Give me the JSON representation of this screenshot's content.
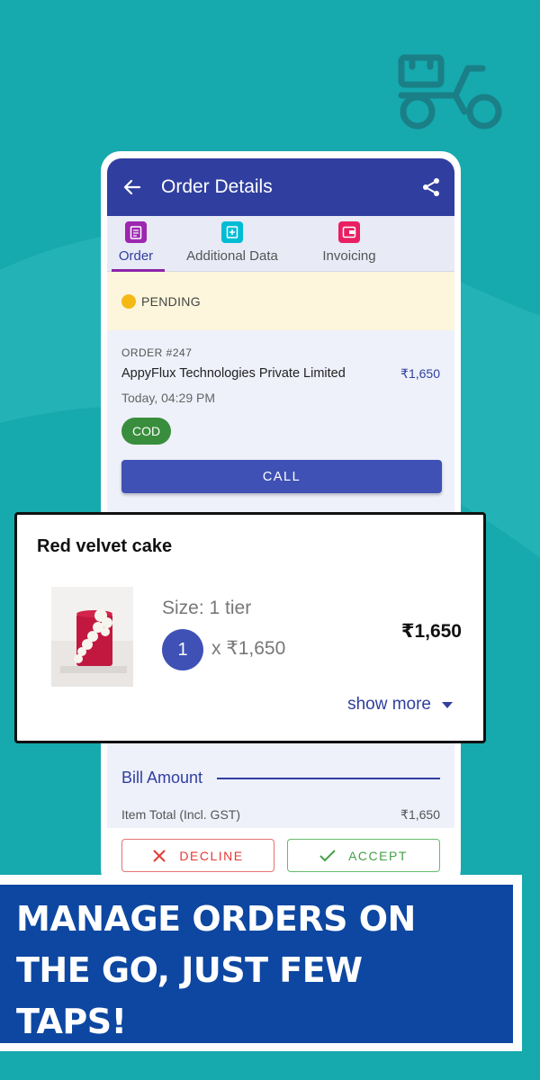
{
  "colors": {
    "background": "#16a9ad",
    "appbar": "#303f9f",
    "banner": "#0d47a1",
    "pending_dot": "#f5b915",
    "cod_badge": "#388e3c"
  },
  "appbar": {
    "title": "Order Details",
    "back_icon": "arrow-back-icon",
    "share_icon": "share-icon"
  },
  "tabs": [
    {
      "label": "Order",
      "icon": "clipboard-icon",
      "color": "#9c27b0",
      "active": true
    },
    {
      "label": "Additional Data",
      "icon": "add-box-icon",
      "color": "#00bcd4",
      "active": false
    },
    {
      "label": "Invoicing",
      "icon": "wallet-icon",
      "color": "#e91e63",
      "active": false
    }
  ],
  "status": {
    "label": "PENDING"
  },
  "order": {
    "number": "ORDER #247",
    "customer": "AppyFlux Technologies Private Limited",
    "amount": "₹1,650",
    "time": "Today, 04:29 PM",
    "payment": "COD",
    "call_label": "CALL"
  },
  "item": {
    "name": "Red velvet cake",
    "size": "Size: 1 tier",
    "quantity": "1",
    "unit_price": "x ₹1,650",
    "total": "₹1,650",
    "show_more": "show more"
  },
  "bill": {
    "title": "Bill Amount",
    "rows": [
      {
        "label": "Item Total (Incl. GST)",
        "value": "₹1,650"
      }
    ]
  },
  "actions": {
    "decline": "DECLINE",
    "accept": "ACCEPT"
  },
  "banner": {
    "lines": [
      "MANAGE ORDERS ON",
      "THE GO, JUST FEW",
      "TAPS!"
    ]
  }
}
